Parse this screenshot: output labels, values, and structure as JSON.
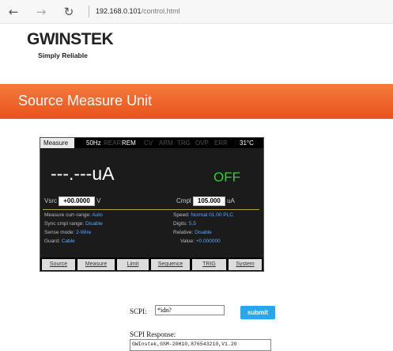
{
  "browser": {
    "back": "←",
    "forward": "→",
    "refresh": "↻",
    "url_host": "192.168.0.101",
    "url_path": "/control.html"
  },
  "logo": {
    "brand": "GWINSTEK",
    "tagline": "Simply Reliable"
  },
  "banner": {
    "title": "Source Measure Unit"
  },
  "device": {
    "status": {
      "mode": "Measure",
      "freq": "50Hz",
      "rear": "REAR",
      "rem": "REM",
      "cv": "CV",
      "arm": "ARM",
      "trg": "TRG",
      "ovp": "OVP",
      "err": "ERR",
      "temp": "31°C"
    },
    "reading": "---.---uA",
    "output_state": "OFF",
    "vsrc_label": "Vsrc",
    "vsrc_value": "+00.0000",
    "vsrc_unit": "V",
    "cmpl_label": "Cmpl",
    "cmpl_value": "105.000",
    "cmpl_unit": "uA",
    "info_left": [
      {
        "label": "Measure curr-range:",
        "value": "Auto"
      },
      {
        "label": "Sync cmpl range:",
        "value": "Disable"
      },
      {
        "label": "Sense mode:",
        "value": "2-Wire"
      },
      {
        "label": "Guard:",
        "value": "Cable"
      }
    ],
    "info_right": [
      {
        "label": "Speed:",
        "value": "Normal  01.00 PLC"
      },
      {
        "label": "Digits:",
        "value": "5.5"
      },
      {
        "label": "Relative:",
        "value": "Disable"
      },
      {
        "label": "Value:",
        "value": "+0.000000"
      }
    ],
    "tabs": [
      "Source",
      "Measure",
      "Limit",
      "Sequence",
      "TRIG",
      "System"
    ]
  },
  "scpi": {
    "label": "SCPI:",
    "input_value": "*idn?",
    "submit_label": "submit",
    "response_label": "SCPI Response:",
    "response_value": "GWInstek,GSM-20H10,876543210,V1.20"
  },
  "colors": {
    "banner": "#e9531b",
    "output_off": "#2fd12f",
    "submit": "#2aa6ea"
  }
}
